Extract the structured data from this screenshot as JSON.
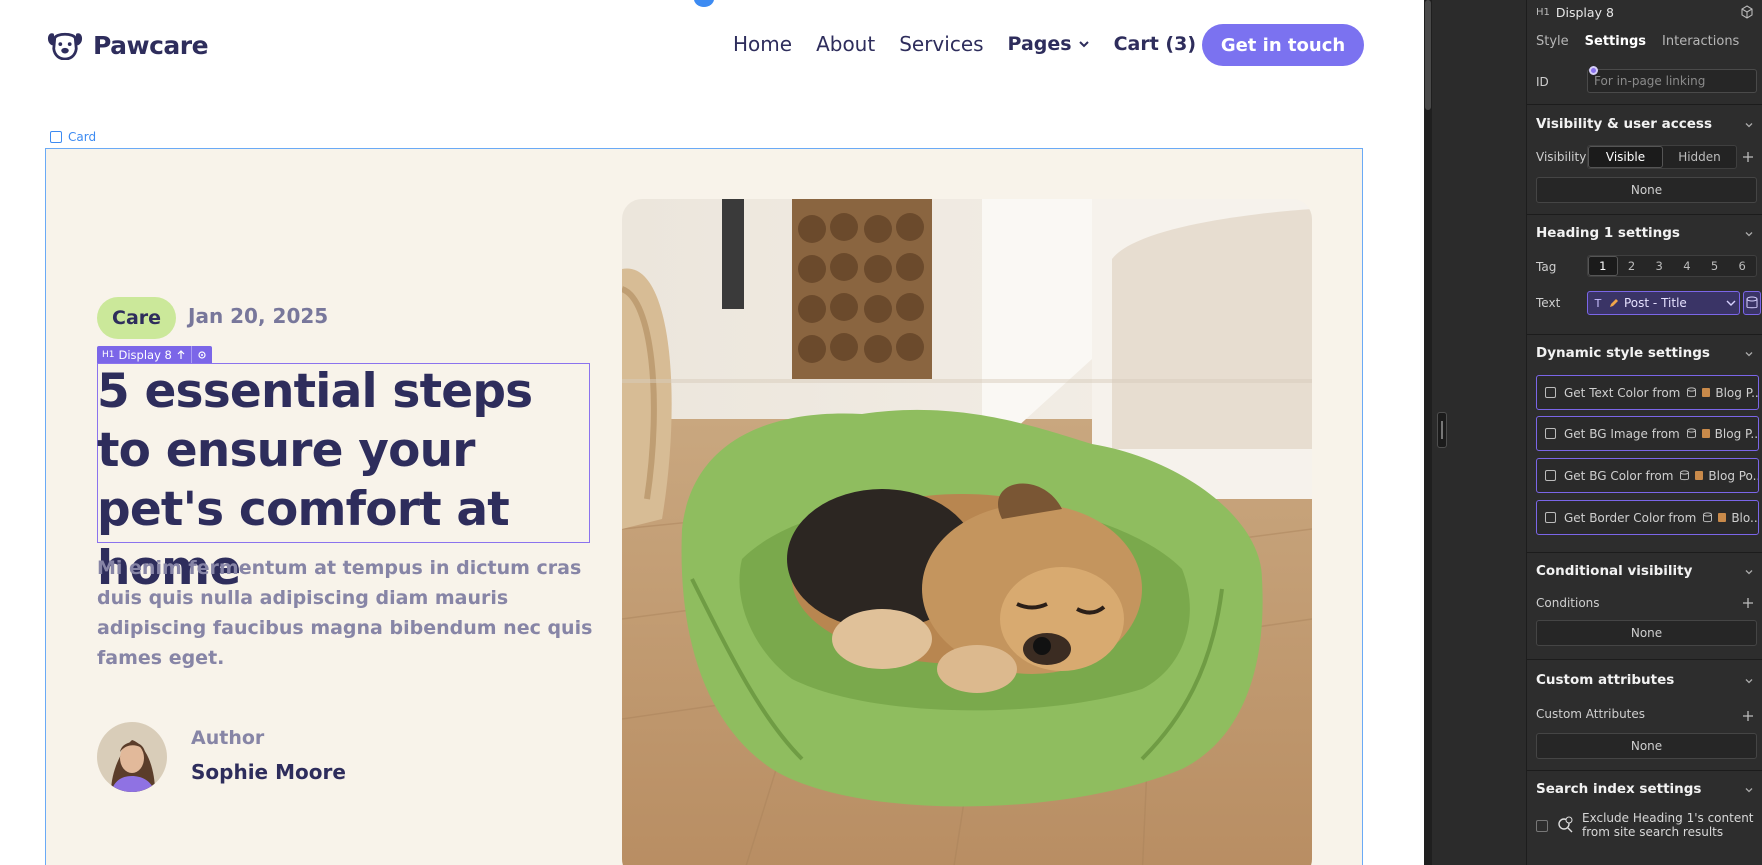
{
  "site": {
    "logo_text": "Pawcare",
    "nav": [
      "Home",
      "About",
      "Services",
      "Pages",
      "Cart (3)"
    ],
    "cta": "Get in touch"
  },
  "canvas": {
    "card_label": "Card",
    "selection": {
      "tag": "H1",
      "style": "Display 8"
    }
  },
  "post": {
    "category": "Care",
    "date": "Jan 20, 2025",
    "title": "5 essential steps to ensure your pet's comfort at home",
    "description": "Mi enim fermentum at tempus in dictum cras duis quis nulla adipiscing diam mauris adipiscing faucibus magna bibendum nec quis fames eget.",
    "author_label": "Author",
    "author_name": "Sophie Moore"
  },
  "panel": {
    "header": {
      "tag": "H1",
      "title": "Display 8"
    },
    "tabs": [
      "Style",
      "Settings",
      "Interactions"
    ],
    "active_tab": "Settings",
    "id": {
      "label": "ID",
      "placeholder": "For in-page linking"
    },
    "visibility": {
      "title": "Visibility & user access",
      "label": "Visibility",
      "options": [
        "Visible",
        "Hidden"
      ],
      "selected": "Visible",
      "value": "None"
    },
    "heading": {
      "title": "Heading 1 settings",
      "tag_label": "Tag",
      "tags": [
        "1",
        "2",
        "3",
        "4",
        "5",
        "6"
      ],
      "selected_tag": "1",
      "text_label": "Text",
      "text_type": "T",
      "text_value": "Post - Title"
    },
    "dynamic": {
      "title": "Dynamic style settings",
      "rows": [
        {
          "label": "Get Text Color from",
          "source": "Blog P..."
        },
        {
          "label": "Get BG Image from",
          "source": "Blog P..."
        },
        {
          "label": "Get BG Color from",
          "source": "Blog Po..."
        },
        {
          "label": "Get Border Color from",
          "source": "Blo..."
        }
      ]
    },
    "conditional": {
      "title": "Conditional visibility",
      "label": "Conditions",
      "value": "None"
    },
    "custom": {
      "title": "Custom attributes",
      "label": "Custom Attributes",
      "value": "None"
    },
    "search": {
      "title": "Search index settings",
      "option": "Exclude Heading 1's content from site search results"
    }
  },
  "colors": {
    "brand": "#2e2d5c",
    "accent": "#7b72f0",
    "care_badge": "#cbe89a",
    "card_bg": "#f8f3ea",
    "selection": "#7b66e8",
    "panel_bg": "#2d2d2d"
  }
}
